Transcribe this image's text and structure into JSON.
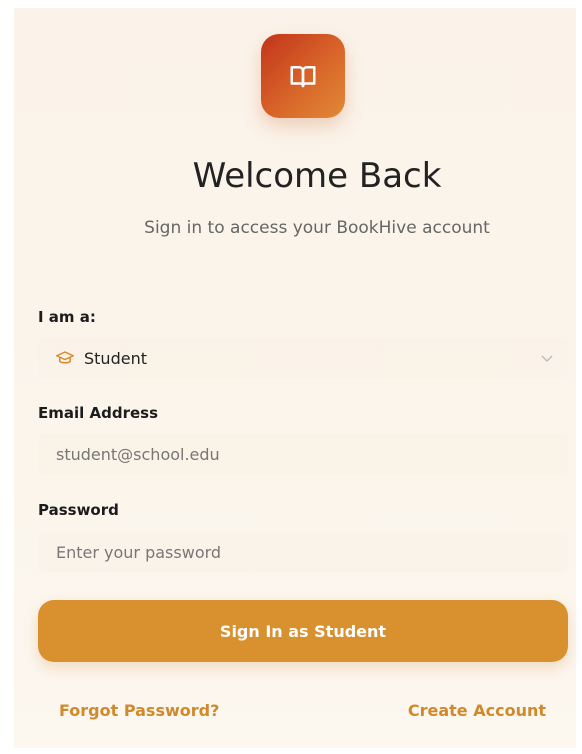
{
  "header": {
    "title": "Welcome Back",
    "subtitle": "Sign in to access your BookHive account"
  },
  "role": {
    "label": "I am a:",
    "selected": "Student",
    "icon": "graduation-cap-icon"
  },
  "email": {
    "label": "Email Address",
    "placeholder": "student@school.edu"
  },
  "password": {
    "label": "Password",
    "placeholder": "Enter your password"
  },
  "actions": {
    "sign_in": "Sign In as Student",
    "forgot": "Forgot Password?",
    "create": "Create Account"
  },
  "colors": {
    "accent": "#d9902f",
    "logo_start": "#c2341a",
    "logo_end": "#e08a35",
    "link": "#d0892c"
  }
}
